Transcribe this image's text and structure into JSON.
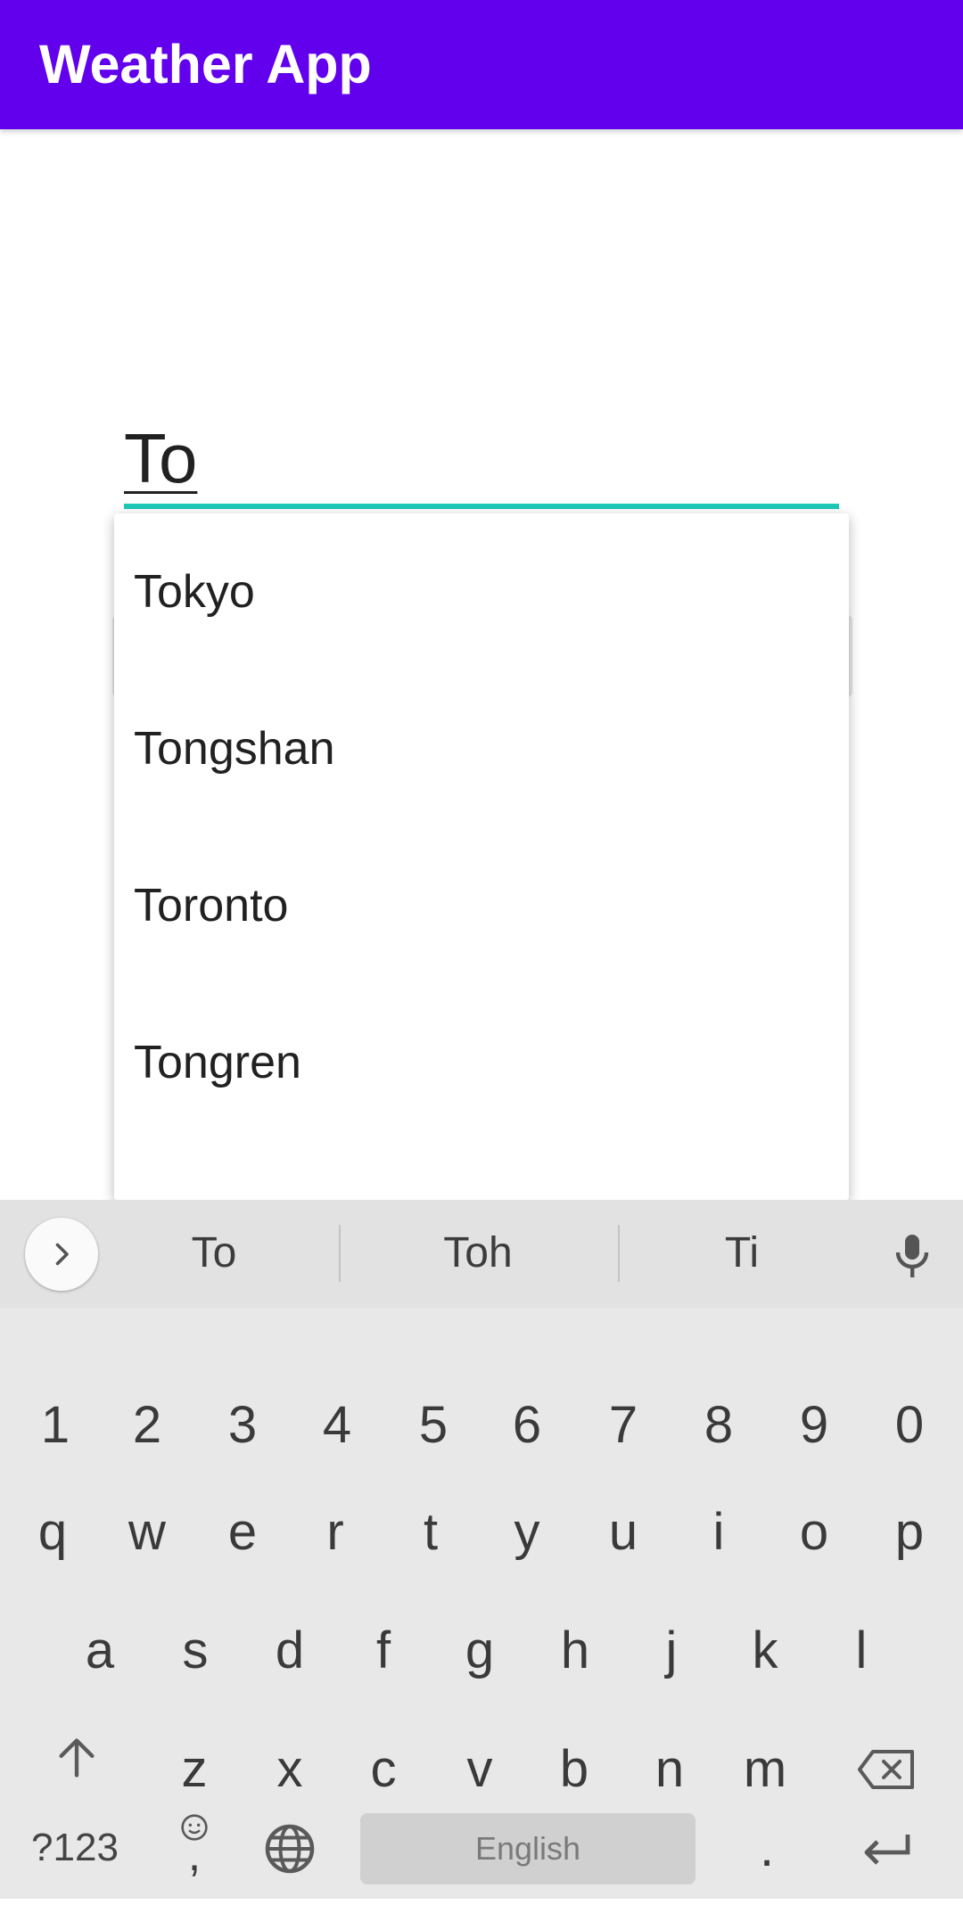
{
  "app_bar": {
    "title": "Weather App",
    "color": "#6200ee"
  },
  "search": {
    "value": "To",
    "underline_color": "#1fc8b7"
  },
  "dropdown": {
    "items": [
      {
        "label": "Tokyo"
      },
      {
        "label": "Tongshan"
      },
      {
        "label": "Toronto"
      },
      {
        "label": "Tongren"
      }
    ]
  },
  "keyboard": {
    "suggestions": [
      "To",
      "Toh",
      "Ti"
    ],
    "expand_icon": "chevron-right-icon",
    "mic_icon": "microphone-icon",
    "number_row": [
      "1",
      "2",
      "3",
      "4",
      "5",
      "6",
      "7",
      "8",
      "9",
      "0"
    ],
    "row1": [
      "q",
      "w",
      "e",
      "r",
      "t",
      "y",
      "u",
      "i",
      "o",
      "p"
    ],
    "row2": [
      "a",
      "s",
      "d",
      "f",
      "g",
      "h",
      "j",
      "k",
      "l"
    ],
    "row3": [
      "z",
      "x",
      "c",
      "v",
      "b",
      "n",
      "m"
    ],
    "shift_icon": "shift-arrow-icon",
    "backspace_icon": "backspace-icon",
    "symbols_label": "?123",
    "comma_label": ",",
    "emoji_icon": "emoji-icon",
    "globe_icon": "globe-icon",
    "space_label": "English",
    "period_label": ".",
    "enter_icon": "enter-icon"
  }
}
